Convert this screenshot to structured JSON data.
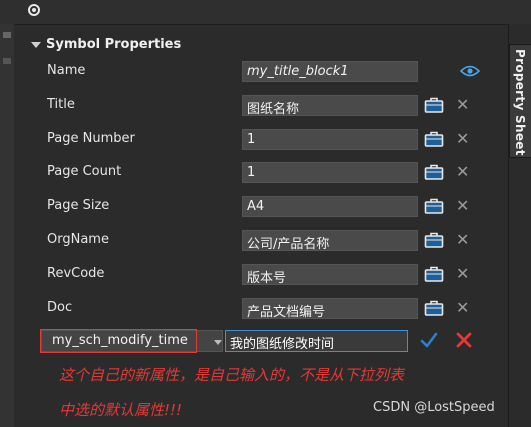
{
  "section_title": "Symbol Properties",
  "side_tab_label": "Property Sheet",
  "properties": [
    {
      "label": "Name",
      "value": "my_title_block1",
      "italic": true,
      "action": "eye-icon"
    },
    {
      "label": "Title",
      "value": "图纸名称",
      "action": "briefcase-icon"
    },
    {
      "label": "Page Number",
      "value": "1",
      "action": "briefcase-icon"
    },
    {
      "label": "Page Count",
      "value": "1",
      "action": "briefcase-icon"
    },
    {
      "label": "Page Size",
      "value": "A4",
      "action": "briefcase-icon"
    },
    {
      "label": "OrgName",
      "value": "公司/产品名称",
      "action": "briefcase-icon"
    },
    {
      "label": "RevCode",
      "value": "版本号",
      "action": "briefcase-icon"
    },
    {
      "label": "Doc",
      "value": "产品文档编号",
      "action": "briefcase-icon"
    }
  ],
  "new_property": {
    "name": "my_sch_modify_time",
    "value": "我的图纸修改时间"
  },
  "annotation": {
    "line1": "这个自己的新属性，是自己输入的，不是从下拉列表",
    "line2": "中选的默认属性!!!"
  },
  "watermark": "CSDN @LostSpeed",
  "colors": {
    "accent": "#3d8fd6",
    "annotation": "#e53935",
    "confirm": "#2f7fd1",
    "cancel": "#e53935"
  }
}
